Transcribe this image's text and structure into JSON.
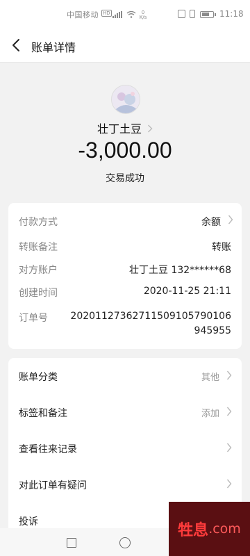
{
  "status_bar": {
    "carrier": "中国移动",
    "hd_badge": "HD",
    "net_speed_value": "0",
    "net_speed_unit": "K/s",
    "time": "11:18"
  },
  "header": {
    "title": "账单详情"
  },
  "summary": {
    "payee": "壮丁土豆",
    "amount": "-3,000.00",
    "status": "交易成功"
  },
  "details": {
    "payment_method_label": "付款方式",
    "payment_method_value": "余额",
    "remark_label": "转账备注",
    "remark_value": "转账",
    "counterparty_label": "对方账户",
    "counterparty_value": "壮丁土豆 132******68",
    "created_label": "创建时间",
    "created_value": "2020-11-25 21:11",
    "order_label": "订单号",
    "order_value": "20201127362711509105790106945955"
  },
  "actions": {
    "category_label": "账单分类",
    "category_value": "其他",
    "tags_label": "标签和备注",
    "tags_value": "添加",
    "history_label": "查看往来记录",
    "question_label": "对此订单有疑问",
    "complaint_label": "投诉"
  },
  "watermark": {
    "text": "牲息",
    "domain": ".com"
  },
  "colors": {
    "background": "#f2f2f2",
    "card": "#ffffff",
    "label": "#888888"
  }
}
